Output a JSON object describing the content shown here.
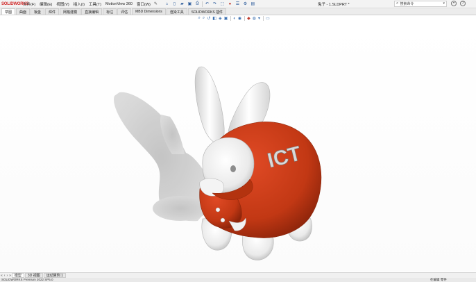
{
  "app": {
    "logo": "SOLIDWORKS",
    "menu": [
      "文件(F)",
      "编辑(E)",
      "视图(V)",
      "插入(I)",
      "工具(T)",
      "MotionView 360",
      "窗口(W)"
    ],
    "doc_title": "兔子 - 1.SLDPRT *",
    "search_placeholder": "搜索命令"
  },
  "tabs": [
    "草图",
    "曲面",
    "钣金",
    "焊件",
    "网格建模",
    "直接编辑",
    "标注",
    "评估",
    "MBD Dimensions",
    "渲染工具",
    "SOLIDWORKS 插件"
  ],
  "bottom_tabs": [
    "模型",
    "3D 视图",
    "运动算例 1"
  ],
  "status": {
    "left": "SOLIDWORKS Premium 2022 SP5.0",
    "right": "在编辑 零件"
  }
}
